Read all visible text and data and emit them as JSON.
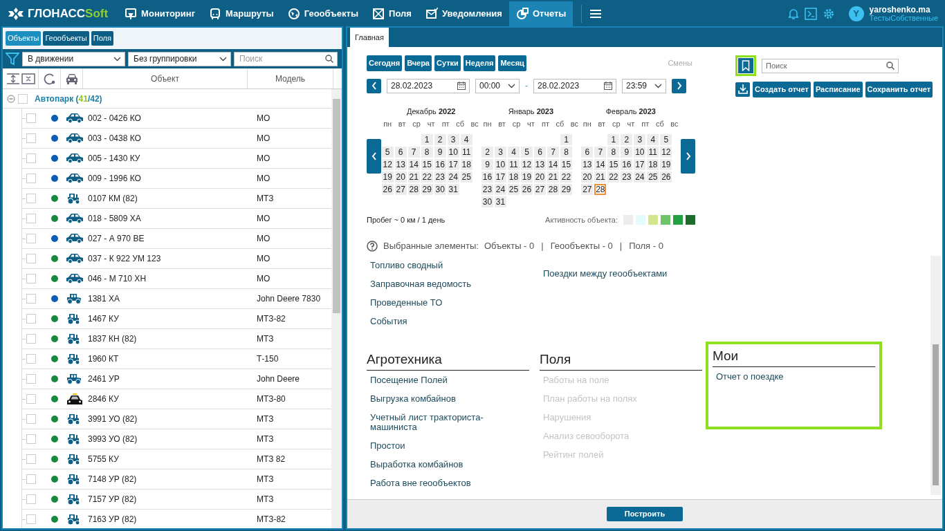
{
  "navbar": {
    "brand_main": "ГЛОНАСС",
    "brand_accent": "Soft",
    "items": [
      {
        "label": "Мониторинг",
        "selected": false
      },
      {
        "label": "Маршруты",
        "selected": false
      },
      {
        "label": "Геообъекты",
        "selected": false
      },
      {
        "label": "Поля",
        "selected": false
      },
      {
        "label": "Уведомления",
        "selected": false
      },
      {
        "label": "Отчеты",
        "selected": true
      }
    ],
    "user": {
      "initial": "Y",
      "name": "yaroshenko.ma",
      "org": "ТестыСобственные"
    }
  },
  "left_panel": {
    "tabs": [
      {
        "label": "Объекты",
        "selected": true
      },
      {
        "label": "Геообъекты",
        "selected": false
      },
      {
        "label": "Поля",
        "selected": false
      }
    ],
    "status_filter": "В движении",
    "grouping": "Без группировки",
    "search_placeholder": "Поиск",
    "columns": [
      "Объект",
      "Модель"
    ],
    "group": {
      "label": "Автопарк",
      "expanded": true,
      "checked": false,
      "open": "(",
      "active": "41",
      "rest": "/42)"
    },
    "rows": [
      {
        "name": "002 - 0426 КО",
        "model": "МО",
        "kind": "car",
        "color": "#0b5cb5",
        "checked": false
      },
      {
        "name": "003 - 0438 КО",
        "model": "МО",
        "kind": "car",
        "color": "#0b5cb5",
        "checked": false
      },
      {
        "name": "005 - 1430 КУ",
        "model": "МО",
        "kind": "car",
        "color": "#0b5cb5",
        "checked": false
      },
      {
        "name": "009 - 1996 КО",
        "model": "МО",
        "kind": "car",
        "color": "#0b5cb5",
        "checked": false
      },
      {
        "name": "0107 КМ (82)",
        "model": "МТЗ",
        "kind": "tractor",
        "color": "#16893c",
        "checked": false
      },
      {
        "name": "018 - 5809 ХА",
        "model": "МО",
        "kind": "car",
        "color": "#16893c",
        "checked": false
      },
      {
        "name": "027 - А 970 ВЕ",
        "model": "МО",
        "kind": "car",
        "color": "#0b5cb5",
        "checked": false
      },
      {
        "name": "037 - К 922 УМ 123",
        "model": "МО",
        "kind": "car",
        "color": "#16893c",
        "checked": false
      },
      {
        "name": "046 - М 710 ХН",
        "model": "МО",
        "kind": "car",
        "color": "#16893c",
        "checked": false
      },
      {
        "name": "1381 ХА",
        "model": "John Deere 7830",
        "kind": "big_tractor",
        "color": "#0b5cb5",
        "checked": false
      },
      {
        "name": "1467 КУ",
        "model": "МТЗ-82",
        "kind": "tractor",
        "color": "#16893c",
        "checked": false
      },
      {
        "name": "1837 КН (82)",
        "model": "МТЗ",
        "kind": "tractor",
        "color": "#16893c",
        "checked": false
      },
      {
        "name": "1960 КТ",
        "model": "Т-150",
        "kind": "tractor",
        "color": "#16893c",
        "checked": false
      },
      {
        "name": "2461 УР",
        "model": "John Deere",
        "kind": "big_tractor",
        "color": "#16893c",
        "checked": false
      },
      {
        "name": "2846 КУ",
        "model": "МТЗ-80",
        "kind": "taxi",
        "color": "#16893c",
        "checked": false
      },
      {
        "name": "3991 УО (82)",
        "model": "МТЗ",
        "kind": "tractor",
        "color": "#16893c",
        "checked": false
      },
      {
        "name": "3993 УО (82)",
        "model": "МТЗ",
        "kind": "tractor",
        "color": "#16893c",
        "checked": false
      },
      {
        "name": "5755 КУ",
        "model": "МТЗ 82",
        "kind": "tractor",
        "color": "#16893c",
        "checked": false
      },
      {
        "name": "7148 УР (82)",
        "model": "МТЗ",
        "kind": "tractor",
        "color": "#16893c",
        "checked": false
      },
      {
        "name": "7157 УР (82)",
        "model": "МТЗ",
        "kind": "tractor",
        "color": "#16893c",
        "checked": false
      },
      {
        "name": "7163 УР (82)",
        "model": "МТЗ-82",
        "kind": "tractor",
        "color": "#16893c",
        "checked": false
      }
    ]
  },
  "right_panel": {
    "tabs": [
      {
        "label": "Главная",
        "selected": true
      }
    ],
    "periods": [
      "Сегодня",
      "Вчера",
      "Сутки",
      "Неделя",
      "Месяц"
    ],
    "shifts_label": "Смены",
    "date_from": "28.02.2023",
    "time_from": "00:00",
    "range_separator": "-",
    "date_to": "28.02.2023",
    "time_to": "23:59",
    "bookmark": {
      "highlighted": true
    },
    "report_search_placeholder": "Поиск",
    "actions": [
      "Создать отчет",
      "Расписание",
      "Сохранить отчет"
    ],
    "months": [
      {
        "title": "Декабрь **2022**",
        "weekdays": [
          "пн",
          "вт",
          "ср",
          "чт",
          "пт",
          "сб",
          "вс"
        ],
        "weeks": [
          [
            {
              "d": "1",
              "selected": false
            },
            {
              "d": "2",
              "selected": false
            },
            {
              "d": "3",
              "selected": false
            },
            {
              "d": "4",
              "selected": false
            }
          ],
          [
            {
              "d": "5",
              "selected": false
            },
            {
              "d": "6",
              "selected": false
            },
            {
              "d": "7",
              "selected": false
            },
            {
              "d": "8",
              "selected": false
            },
            {
              "d": "9",
              "selected": false
            },
            {
              "d": "10",
              "selected": false
            },
            {
              "d": "11",
              "selected": false
            }
          ],
          [
            {
              "d": "12",
              "selected": false
            },
            {
              "d": "13",
              "selected": false
            },
            {
              "d": "14",
              "selected": false
            },
            {
              "d": "15",
              "selected": false
            },
            {
              "d": "16",
              "selected": false
            },
            {
              "d": "17",
              "selected": false
            },
            {
              "d": "18",
              "selected": false
            }
          ],
          [
            {
              "d": "19",
              "selected": false
            },
            {
              "d": "20",
              "selected": false
            },
            {
              "d": "21",
              "selected": false
            },
            {
              "d": "22",
              "selected": false
            },
            {
              "d": "23",
              "selected": false
            },
            {
              "d": "24",
              "selected": false
            },
            {
              "d": "25",
              "selected": false
            }
          ],
          [
            {
              "d": "26",
              "selected": false
            },
            {
              "d": "27",
              "selected": false
            },
            {
              "d": "28",
              "selected": false
            },
            {
              "d": "29",
              "selected": false
            },
            {
              "d": "30",
              "selected": false
            },
            {
              "d": "31",
              "selected": false
            }
          ]
        ]
      },
      {
        "title": "Январь **2023**",
        "weekdays": [
          "пн",
          "вт",
          "ср",
          "чт",
          "пт",
          "сб",
          "вс"
        ],
        "weeks": [
          [
            {
              "d": "1",
              "selected": false
            }
          ],
          [
            {
              "d": "2",
              "selected": false
            },
            {
              "d": "3",
              "selected": false
            },
            {
              "d": "4",
              "selected": false
            },
            {
              "d": "5",
              "selected": false
            },
            {
              "d": "6",
              "selected": false
            },
            {
              "d": "7",
              "selected": false
            },
            {
              "d": "8",
              "selected": false
            }
          ],
          [
            {
              "d": "9",
              "selected": false
            },
            {
              "d": "10",
              "selected": false
            },
            {
              "d": "11",
              "selected": false
            },
            {
              "d": "12",
              "selected": false
            },
            {
              "d": "13",
              "selected": false
            },
            {
              "d": "14",
              "selected": false
            },
            {
              "d": "15",
              "selected": false
            }
          ],
          [
            {
              "d": "16",
              "selected": false
            },
            {
              "d": "17",
              "selected": false
            },
            {
              "d": "18",
              "selected": false
            },
            {
              "d": "19",
              "selected": false
            },
            {
              "d": "20",
              "selected": false
            },
            {
              "d": "21",
              "selected": false
            },
            {
              "d": "22",
              "selected": false
            }
          ],
          [
            {
              "d": "23",
              "selected": false
            },
            {
              "d": "24",
              "selected": false
            },
            {
              "d": "25",
              "selected": false
            },
            {
              "d": "26",
              "selected": false
            },
            {
              "d": "27",
              "selected": false
            },
            {
              "d": "28",
              "selected": false
            },
            {
              "d": "29",
              "selected": false
            }
          ],
          [
            {
              "d": "30",
              "selected": false
            },
            {
              "d": "31",
              "selected": false
            }
          ]
        ]
      },
      {
        "title": "Февраль **2023**",
        "weekdays": [
          "пн",
          "вт",
          "ср",
          "чт",
          "пт",
          "сб",
          "вс"
        ],
        "weeks": [
          [
            {
              "d": "1",
              "selected": false
            },
            {
              "d": "2",
              "selected": false
            },
            {
              "d": "3",
              "selected": false
            },
            {
              "d": "4",
              "selected": false
            },
            {
              "d": "5",
              "selected": false
            }
          ],
          [
            {
              "d": "6",
              "selected": false
            },
            {
              "d": "7",
              "selected": false
            },
            {
              "d": "8",
              "selected": false
            },
            {
              "d": "9",
              "selected": false
            },
            {
              "d": "10",
              "selected": false
            },
            {
              "d": "11",
              "selected": false
            },
            {
              "d": "12",
              "selected": false
            }
          ],
          [
            {
              "d": "13",
              "selected": false
            },
            {
              "d": "14",
              "selected": false
            },
            {
              "d": "15",
              "selected": false
            },
            {
              "d": "16",
              "selected": false
            },
            {
              "d": "17",
              "selected": false
            },
            {
              "d": "18",
              "selected": false
            },
            {
              "d": "19",
              "selected": false
            }
          ],
          [
            {
              "d": "20",
              "selected": false
            },
            {
              "d": "21",
              "selected": false
            },
            {
              "d": "22",
              "selected": false
            },
            {
              "d": "23",
              "selected": false
            },
            {
              "d": "24",
              "selected": false
            },
            {
              "d": "25",
              "selected": false
            },
            {
              "d": "26",
              "selected": false
            }
          ],
          [
            {
              "d": "27",
              "selected": false
            },
            {
              "d": "28",
              "selected": true
            }
          ]
        ]
      }
    ],
    "mileage": "Пробег ~ 0 км / 1 день",
    "activity_label": "Активность объекта:",
    "activity_levels": [
      {
        "color": "#ececec"
      },
      {
        "color": "#e3fbfd"
      },
      {
        "color": "#d3e68e"
      },
      {
        "color": "#6fc36b"
      },
      {
        "color": "#23a042"
      },
      {
        "color": "#1c6b2b"
      }
    ],
    "selection_label": "Выбранные элементы:",
    "selection_parts": [
      {
        "kind": "count",
        "text": "Объекты - 0"
      },
      {
        "kind": "separator",
        "text": "|"
      },
      {
        "kind": "count",
        "text": "Геообъекты - 0"
      },
      {
        "kind": "separator",
        "text": "|"
      },
      {
        "kind": "count",
        "text": "Поля - 0"
      }
    ],
    "report_rows": [
      {
        "sections": [
          {
            "highlighted": false,
            "items": [
              {
                "label": "Топливо сводный",
                "disabled": false
              },
              {
                "label": "Заправочная ведомость",
                "disabled": false
              },
              {
                "label": "Проведенные ТО",
                "disabled": false
              },
              {
                "label": "События",
                "disabled": false
              }
            ]
          },
          {
            "highlighted": false,
            "items": [
              {
                "label": "Поездки между геообъектами",
                "disabled": false
              }
            ]
          }
        ]
      },
      {
        "sections": [
          {
            "title": "Агротехника",
            "highlighted": false,
            "items": [
              {
                "label": "Посещение Полей",
                "disabled": false
              },
              {
                "label": "Выгрузка комбайнов",
                "disabled": false
              },
              {
                "label": "Учетный лист тракториста-машиниста",
                "disabled": false
              },
              {
                "label": "Простои",
                "disabled": false
              },
              {
                "label": "Выработка комбайнов",
                "disabled": false
              },
              {
                "label": "Работа вне геообъектов",
                "disabled": false
              }
            ]
          },
          {
            "title": "Поля",
            "highlighted": false,
            "items": [
              {
                "label": "Работы на поле",
                "disabled": true
              },
              {
                "label": "План работы на полях",
                "disabled": true
              },
              {
                "label": "Нарушения",
                "disabled": true
              },
              {
                "label": "Анализ севооборота",
                "disabled": true
              },
              {
                "label": "Рейтинг полей",
                "disabled": true
              }
            ]
          },
          {
            "title": "Мои",
            "highlighted": true,
            "items": [
              {
                "label": "Отчет о поездке",
                "disabled": false
              }
            ]
          }
        ]
      }
    ],
    "build_button": "Построить"
  }
}
